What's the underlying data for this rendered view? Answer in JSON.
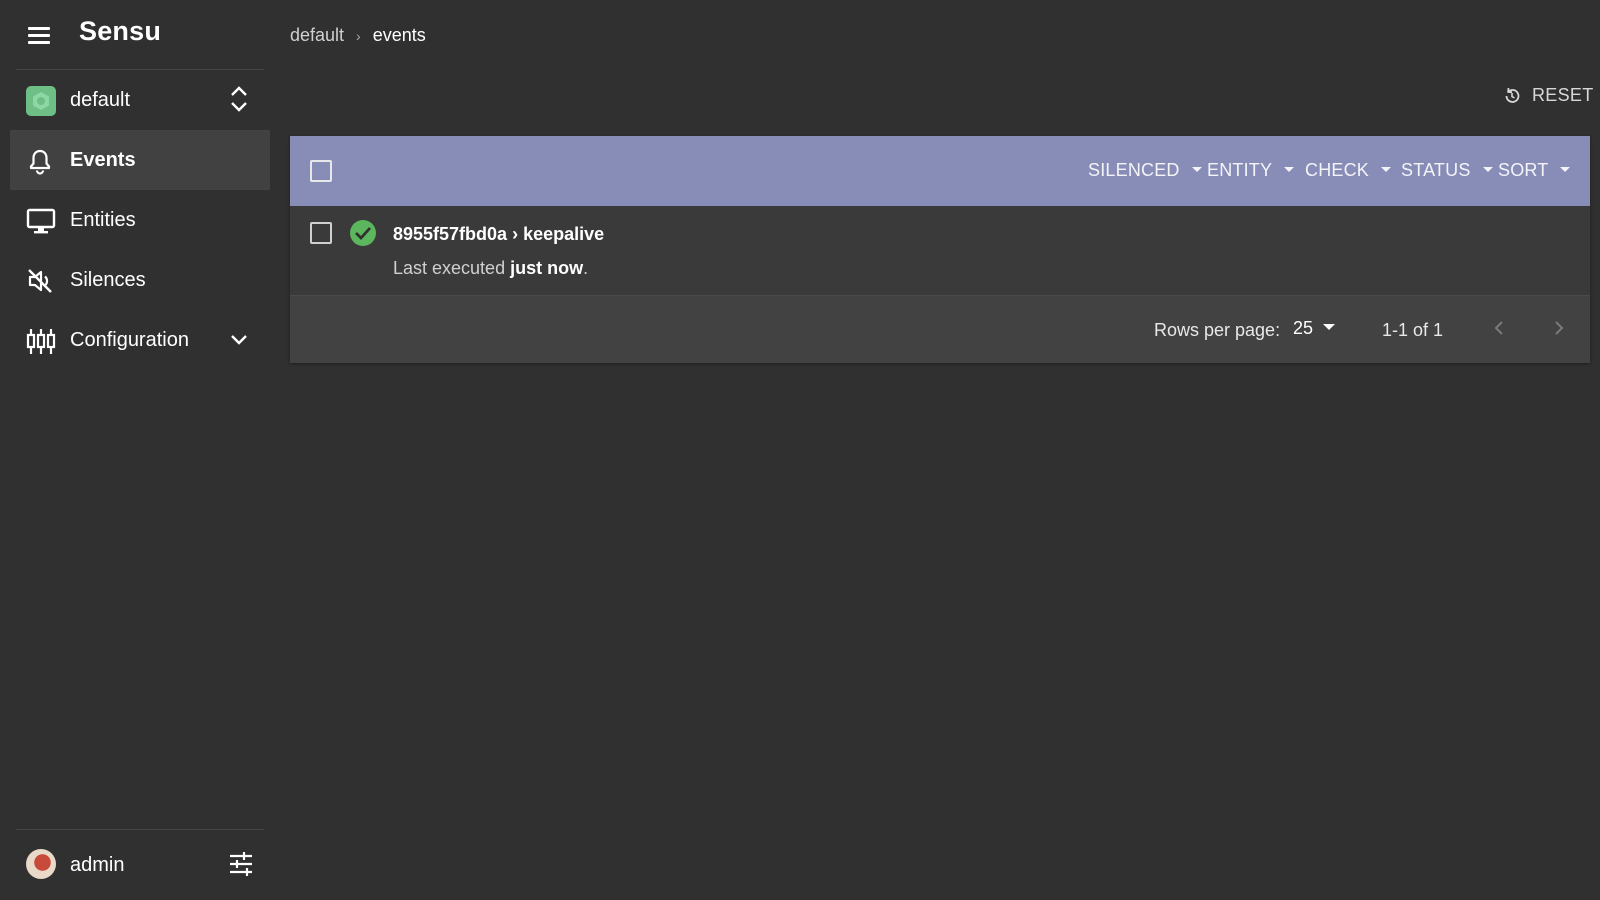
{
  "app": {
    "brand": "Sensu"
  },
  "namespace": {
    "label": "default"
  },
  "nav": [
    {
      "label": "Events",
      "icon": "bell-icon",
      "active": true
    },
    {
      "label": "Entities",
      "icon": "monitor-icon"
    },
    {
      "label": "Silences",
      "icon": "volume-off-icon"
    },
    {
      "label": "Configuration",
      "icon": "equalizer-icon"
    }
  ],
  "user": {
    "name": "admin"
  },
  "breadcrumb": {
    "namespace": "default",
    "separator": "›",
    "current": "events"
  },
  "toolbar": {
    "reset_label": "RESET",
    "filters": {
      "silenced": "SILENCED",
      "entity": "ENTITY",
      "check": "CHECK",
      "status": "STATUS",
      "sort": "SORT"
    }
  },
  "events": [
    {
      "entity": "8955f57fbd0a",
      "arrow": "›",
      "check": "keepalive",
      "status": "ok",
      "sub_prefix": "Last executed",
      "sub_time": "just now",
      "sub_suffix": "."
    }
  ],
  "pagination": {
    "rows_label": "Rows per page:",
    "rows_value": "25",
    "range": "1-1 of 1"
  },
  "colors": {
    "background": "#303030",
    "toolbar": "#888db8",
    "status_ok": "#5bb65e",
    "namespace_avatar": "#6dbf85"
  }
}
